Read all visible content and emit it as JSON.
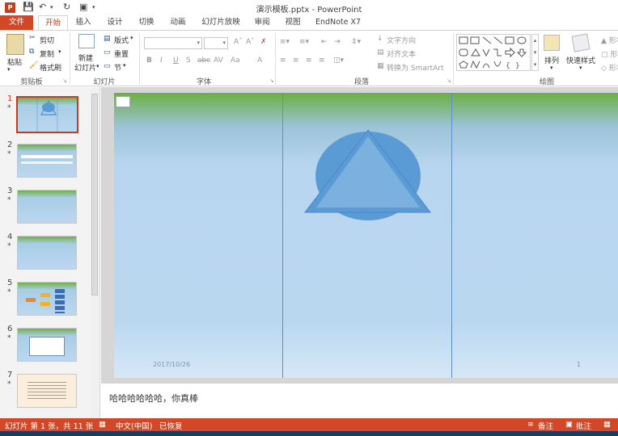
{
  "window": {
    "title": "演示模板.pptx - PowerPoint",
    "app_icon": "P"
  },
  "qat": [
    "save-icon",
    "undo-icon",
    "redo-icon",
    "present-icon"
  ],
  "tabs": [
    {
      "label": "文件"
    },
    {
      "label": "开始"
    },
    {
      "label": "插入"
    },
    {
      "label": "设计"
    },
    {
      "label": "切换"
    },
    {
      "label": "动画"
    },
    {
      "label": "幻灯片放映"
    },
    {
      "label": "审阅"
    },
    {
      "label": "视图"
    },
    {
      "label": "EndNote X7"
    }
  ],
  "ribbon": {
    "clipboard": {
      "label": "剪贴板",
      "paste": "粘贴",
      "cut": "剪切",
      "copy": "复制",
      "format_painter": "格式刷"
    },
    "slides": {
      "label": "幻灯片",
      "new_slide_1": "新建",
      "new_slide_2": "幻灯片",
      "layout": "版式",
      "reset": "重置",
      "section": "节"
    },
    "font": {
      "label": "字体",
      "bold": "B",
      "italic": "I",
      "underline": "U",
      "shadow": "S",
      "strike": "abc",
      "spacing": "AV",
      "case": "Aa",
      "color": "A"
    },
    "paragraph": {
      "label": "段落",
      "text_direction": "文字方向",
      "align_text": "对齐文本",
      "smartart": "转换为 SmartArt"
    },
    "drawing": {
      "label": "绘图",
      "arrange": "排列",
      "quick_styles": "快速样式",
      "shape_fill": "形状"
    }
  },
  "slides": [
    {
      "num": "1",
      "star": "*"
    },
    {
      "num": "2",
      "star": "*"
    },
    {
      "num": "3",
      "star": "*"
    },
    {
      "num": "4",
      "star": "*"
    },
    {
      "num": "5",
      "star": "*"
    },
    {
      "num": "6",
      "star": "*"
    },
    {
      "num": "7",
      "star": "*"
    }
  ],
  "slide": {
    "date": "2017/10/26",
    "number": "1"
  },
  "notes": {
    "text": "哈哈哈哈哈哈，你真棒"
  },
  "status": {
    "slide_info": "幻灯片 第 1 张，共 11 张",
    "language": "中文(中国)",
    "recovered": "已恢复",
    "notes_btn": "备注",
    "comments_btn": "批注"
  },
  "colors": {
    "accent": "#d24726",
    "shape_fill": "#5b9bd5",
    "slide_top": "#6eae44",
    "slide_body": "#bad7f0"
  }
}
